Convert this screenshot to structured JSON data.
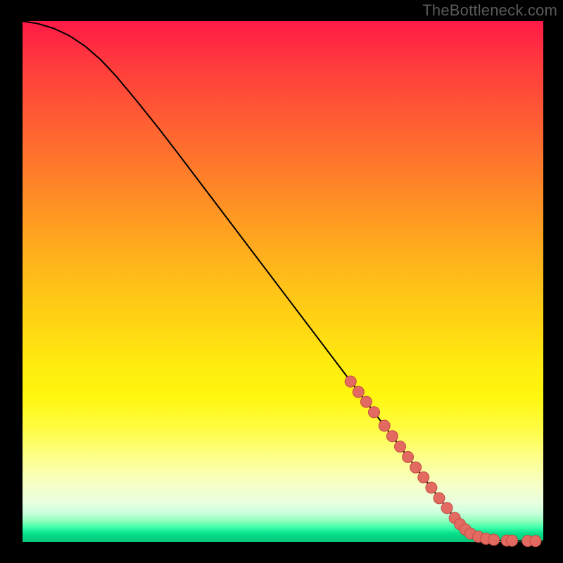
{
  "watermark": "TheBottleneck.com",
  "colors": {
    "curve": "#000000",
    "dot_fill": "#e36a61",
    "dot_stroke": "#c24b44",
    "background": "#000000"
  },
  "chart_data": {
    "type": "line",
    "title": "",
    "xlabel": "",
    "ylabel": "",
    "xlim": [
      0,
      100
    ],
    "ylim": [
      0,
      100
    ],
    "series": [
      {
        "name": "curve",
        "x": [
          0,
          3,
          6,
          9,
          12,
          15,
          18,
          22,
          26,
          30,
          35,
          40,
          45,
          50,
          55,
          60,
          65,
          70,
          75,
          80,
          83,
          85,
          87,
          90,
          93,
          96,
          100
        ],
        "y": [
          100,
          99.5,
          98.6,
          97.2,
          95.2,
          92.6,
          89.4,
          84.6,
          79.6,
          74.4,
          67.8,
          61.2,
          54.6,
          48.0,
          41.4,
          34.8,
          28.2,
          21.6,
          15.0,
          8.4,
          4.6,
          2.4,
          1.0,
          0.35,
          0.22,
          0.18,
          0.15
        ]
      }
    ],
    "markers": {
      "name": "highlighted-segment",
      "x": [
        63,
        64.5,
        66,
        67.5,
        69.5,
        71,
        72.5,
        74,
        75.5,
        77,
        78.5,
        80,
        81.5,
        83,
        84,
        85,
        86,
        87.5,
        89,
        90.5,
        93,
        94,
        97,
        98.5
      ],
      "y": [
        30.8,
        28.8,
        26.9,
        24.9,
        22.3,
        20.3,
        18.3,
        16.3,
        14.3,
        12.4,
        10.4,
        8.4,
        6.5,
        4.6,
        3.4,
        2.4,
        1.6,
        1.0,
        0.6,
        0.4,
        0.26,
        0.24,
        0.19,
        0.17
      ]
    }
  }
}
